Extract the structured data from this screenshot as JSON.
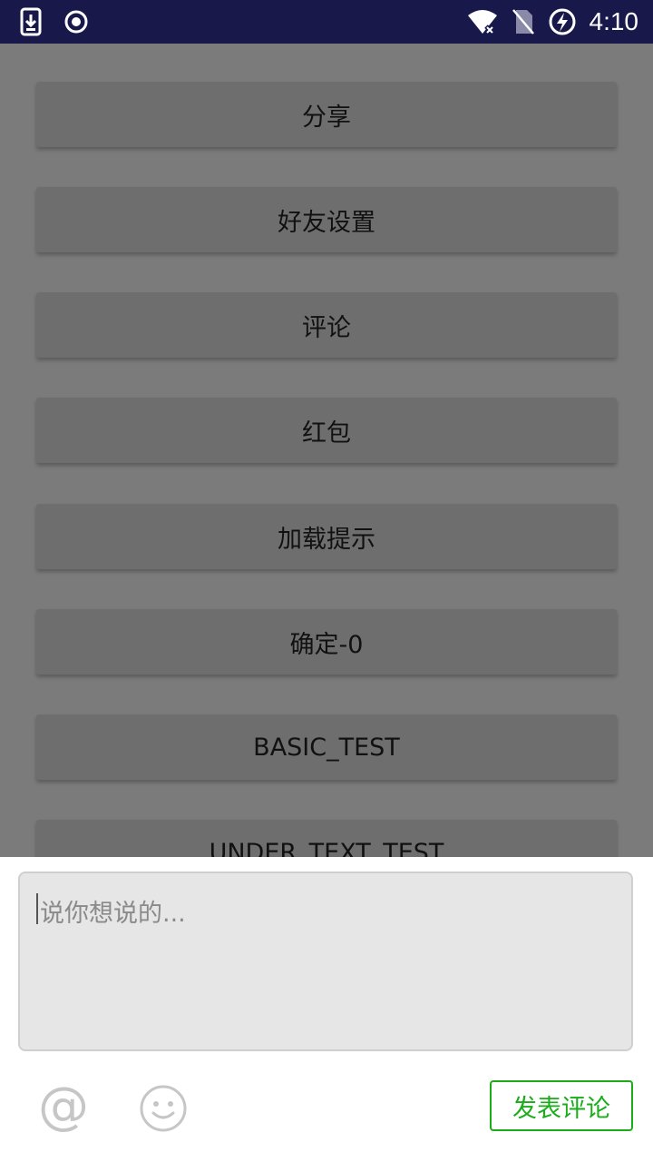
{
  "status_bar": {
    "time": "4:10",
    "icons": [
      "download-icon",
      "record-icon",
      "wifi-off-icon",
      "no-sim-icon",
      "battery-charging-icon"
    ]
  },
  "buttons": [
    {
      "label": "分享"
    },
    {
      "label": "好友设置"
    },
    {
      "label": "评论"
    },
    {
      "label": "红包"
    },
    {
      "label": "加载提示"
    },
    {
      "label": "确定-0"
    },
    {
      "label": "BASIC_TEST"
    },
    {
      "label": "UNDER_TEXT_TEST"
    }
  ],
  "comment_sheet": {
    "input_placeholder": "说你想说的...",
    "input_value": "",
    "at_symbol": "@",
    "submit_label": "发表评论",
    "accent_color": "#1aad19"
  }
}
